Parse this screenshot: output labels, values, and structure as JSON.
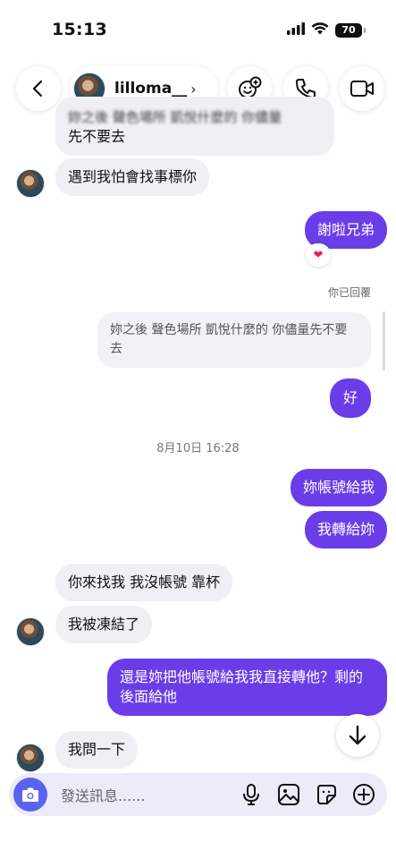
{
  "status_bar": {
    "time": "15:13",
    "battery": "70"
  },
  "header": {
    "username": "lilloma__",
    "chevron": "›"
  },
  "messages": {
    "m1": "妳之後 聲色場所 凱悅什麼的 你儘量",
    "m1b": "先不要去",
    "m2": "遇到我怕會找事標你",
    "m3": "謝啦兄弟",
    "replied_label": "你已回覆",
    "quoted": "妳之後 聲色場所 凱悅什麼的 你儘量先不要去",
    "m4": "好",
    "timestamp": "8月10日 16:28",
    "m5": "妳帳號給我",
    "m6": "我轉給妳",
    "m7": "你來找我 我沒帳號 靠杯",
    "m8": "我被凍結了",
    "m9": "還是妳把他帳號給我我直接轉他？剩的後面給他",
    "m10": "我問一下"
  },
  "reaction": {
    "emoji": "❤"
  },
  "composer": {
    "placeholder": "發送訊息......"
  },
  "colors": {
    "accent_purple": "#6b3de8",
    "camera_blue": "#5a63f2",
    "received_bubble": "#efeff4"
  }
}
